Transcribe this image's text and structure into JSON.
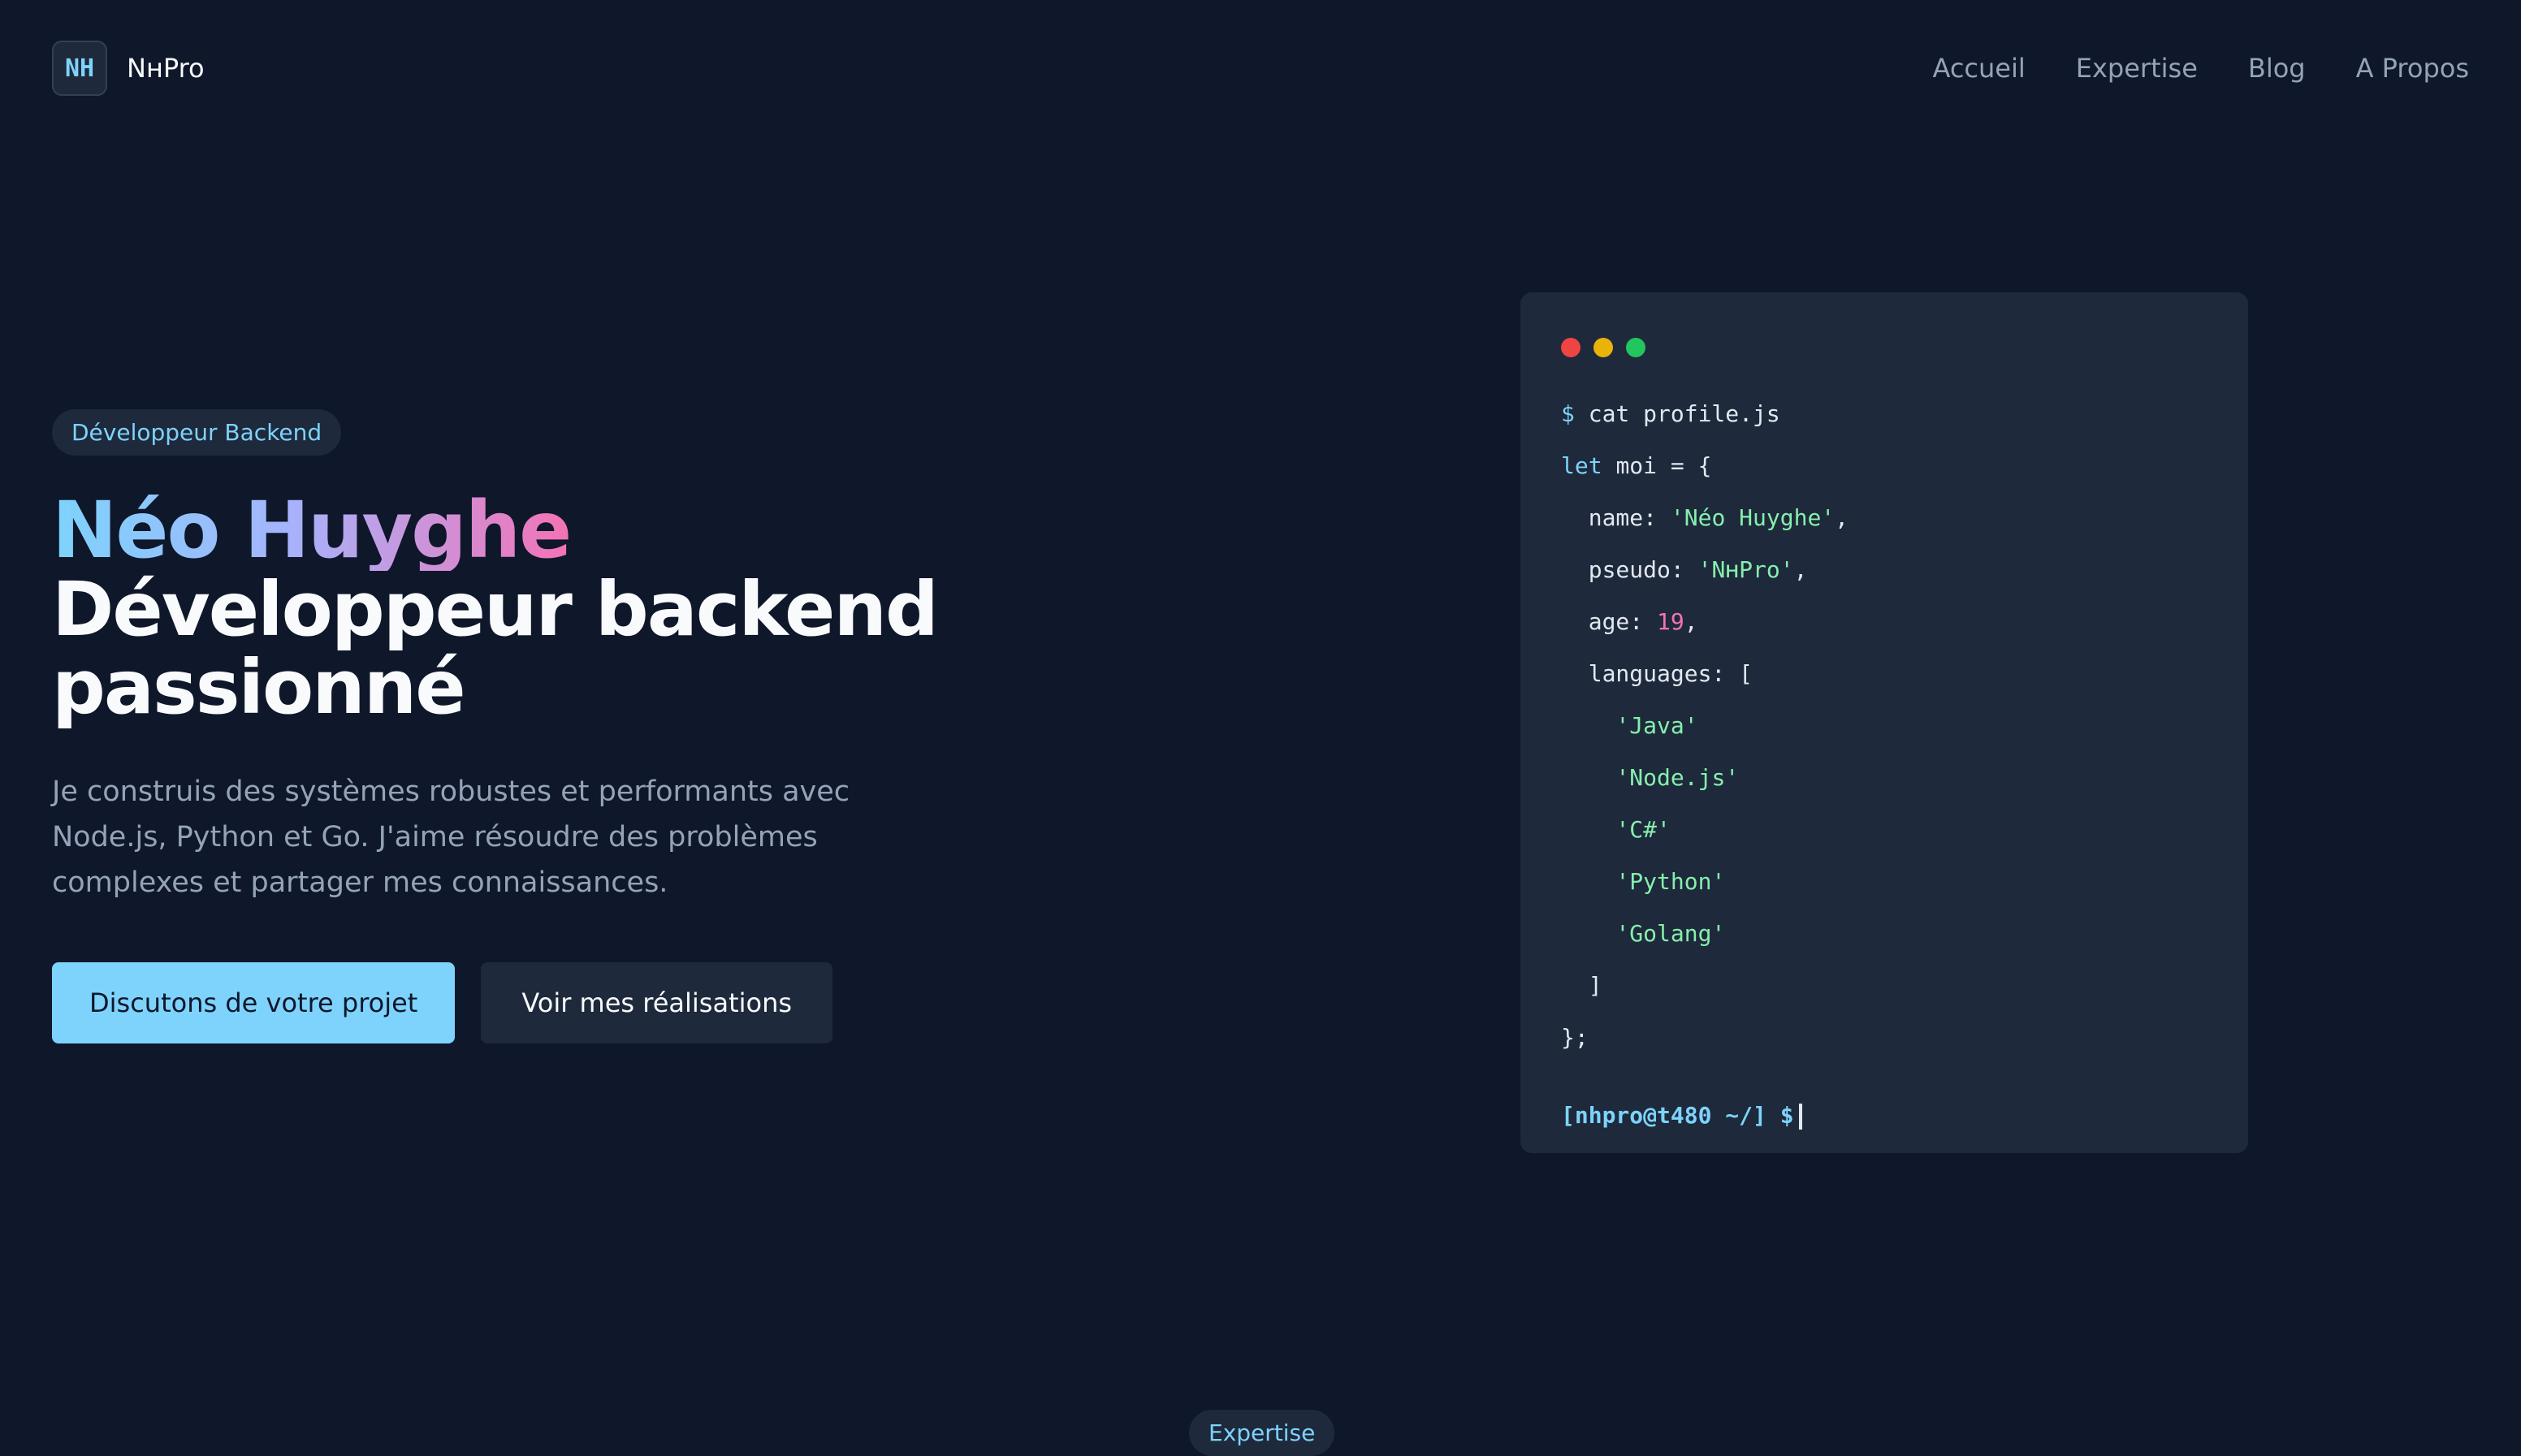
{
  "brand": {
    "badge": "NH",
    "name": "NʜPro"
  },
  "nav": {
    "links": [
      "Accueil",
      "Expertise",
      "Blog",
      "A Propos"
    ]
  },
  "hero": {
    "pill": "Développeur Backend",
    "name": "Néo Huyghe",
    "title_line1": "Développeur backend",
    "title_line2": "passionné",
    "description": "Je construis des systèmes robustes et performants avec Node.js, Python et Go. J'aime résoudre des problèmes complexes et partager mes connaissances.",
    "primary_button": "Discutons de votre projet",
    "secondary_button": "Voir mes réalisations"
  },
  "terminal": {
    "dot_colors": [
      "#ef4444",
      "#eab308",
      "#22c55e"
    ],
    "command_symbol": "$",
    "command": "cat profile.js",
    "keyword": "let",
    "var_decl": "moi = {",
    "fields": {
      "name_key": "name:",
      "name_value": "'Néo Huyghe'",
      "pseudo_key": "pseudo:",
      "pseudo_value": "'NʜPro'",
      "age_key": "age:",
      "age_value": "19",
      "languages_key": "languages: ["
    },
    "languages": [
      "'Java'",
      "'Node.js'",
      "'C#'",
      "'Python'",
      "'Golang'"
    ],
    "array_close": "]",
    "object_close": "};",
    "prompt": "[nhpro@t480 ~/] $"
  },
  "section_pill": "Expertise",
  "colors": {
    "background": "#0f172a",
    "surface": "#1e293b",
    "accent": "#7dd3fc",
    "string": "#86efac",
    "number": "#f472b6"
  }
}
